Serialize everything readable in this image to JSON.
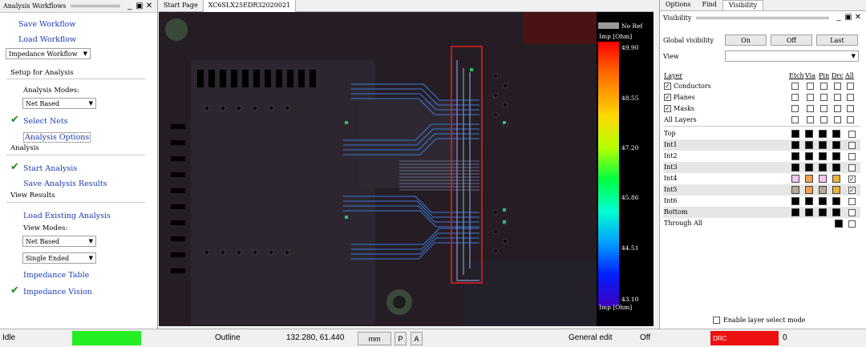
{
  "left_panel": {
    "title": "Analysis Workflows",
    "save_workflow": "Save Workflow",
    "load_workflow": "Load Workflow",
    "workflow_select": "Impedance Workflow",
    "setup_heading": "Setup for Analysis",
    "analysis_modes_label": "Analysis Modes:",
    "analysis_mode_select": "Net Based",
    "select_nets": "Select Nets",
    "analysis_options": "Analysis Options",
    "analysis_heading": "Analysis",
    "start_analysis": "Start Analysis",
    "save_results": "Save Analysis Results",
    "view_results_heading": "View Results",
    "load_existing": "Load Existing Analysis",
    "view_modes_label": "View Modes:",
    "view_mode_select": "Net Based",
    "ended_select": "Single Ended",
    "impedance_table": "Impedance Table",
    "impedance_vision": "Impedance Vision"
  },
  "tabs": [
    "Start Page",
    "XC6SLX25EDR32020021"
  ],
  "legend": {
    "no_ref": "No Ref",
    "unit_top": "Imp [Ohm]",
    "unit_bottom": "Imp [Ohm]",
    "ticks": [
      "49.90",
      "48.55",
      "47.20",
      "45.86",
      "44.51",
      "43.10"
    ],
    "no_ref_color": "#9a9a9a"
  },
  "right_panel": {
    "tabs": [
      "Options",
      "Find",
      "Visibility"
    ],
    "title": "Visibility",
    "global_visibility_label": "Global visibility",
    "btn_on": "On",
    "btn_off": "Off",
    "btn_last": "Last",
    "view_label": "View",
    "layer_header": "Layer",
    "col_headers": [
      "Etch",
      "Via",
      "Pin",
      "Drc",
      "All"
    ],
    "top_layers": [
      "Conductors",
      "Planes",
      "Masks"
    ],
    "all_layers": "All Layers",
    "layers": [
      {
        "name": "Top",
        "colors": [
          "#000000",
          "#000000",
          "#000000",
          "#000000"
        ],
        "all": false
      },
      {
        "name": "Int1",
        "colors": [
          "#000000",
          "#000000",
          "#000000",
          "#000000"
        ],
        "all": false
      },
      {
        "name": "Int2",
        "colors": [
          "#000000",
          "#000000",
          "#000000",
          "#000000"
        ],
        "all": false
      },
      {
        "name": "Int3",
        "colors": [
          "#000000",
          "#000000",
          "#000000",
          "#000000"
        ],
        "all": false
      },
      {
        "name": "Int4",
        "colors": [
          "#f4c6ee",
          "#f0a050",
          "#f4c6ee",
          "#f0b030"
        ],
        "all": true
      },
      {
        "name": "Int5",
        "colors": [
          "#b8a898",
          "#f0a050",
          "#b8a898",
          "#f0b030"
        ],
        "all": true
      },
      {
        "name": "Int6",
        "colors": [
          "#000000",
          "#000000",
          "#000000",
          "#000000"
        ],
        "all": false
      },
      {
        "name": "Bottom",
        "colors": [
          "#000000",
          "#000000",
          "#000000",
          "#000000"
        ],
        "all": false
      }
    ],
    "through_all": "Through All",
    "enable_layer_select": "Enable layer select mode"
  },
  "status_bar": {
    "state": "Idle",
    "state_color": "#22ee22",
    "mode": "Outline",
    "coords": "132.280, 61.440",
    "units": "mm",
    "btn_p": "P",
    "btn_a": "A",
    "edit_mode": "General edit",
    "off": "Off",
    "drc_label": "DRC",
    "drc_color": "#ee1111",
    "drc_count": "0"
  }
}
